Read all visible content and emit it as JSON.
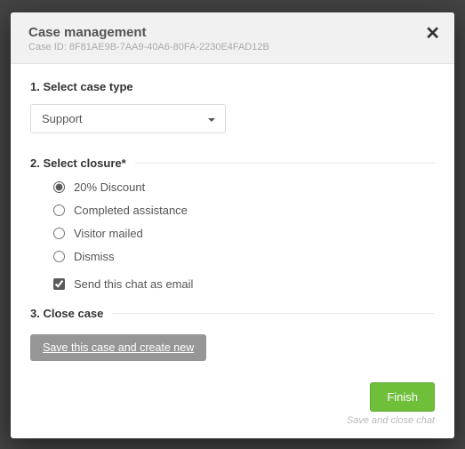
{
  "header": {
    "title": "Case management",
    "case_id_label": "Case ID: 8F81AE9B-7AA9-40A6-80FA-2230E4FAD12B"
  },
  "step1": {
    "label": "1. Select case type",
    "selected": "Support"
  },
  "step2": {
    "label": "2. Select closure*",
    "options": [
      {
        "label": "20% Discount",
        "checked": true
      },
      {
        "label": "Completed assistance",
        "checked": false
      },
      {
        "label": "Visitor mailed",
        "checked": false
      },
      {
        "label": "Dismiss",
        "checked": false
      }
    ],
    "send_email_label": "Send this chat as email",
    "send_email_checked": true
  },
  "step3": {
    "label": "3. Close case",
    "save_button": "Save this case and create new"
  },
  "footer": {
    "finish": "Finish",
    "hint": "Save and close chat"
  }
}
